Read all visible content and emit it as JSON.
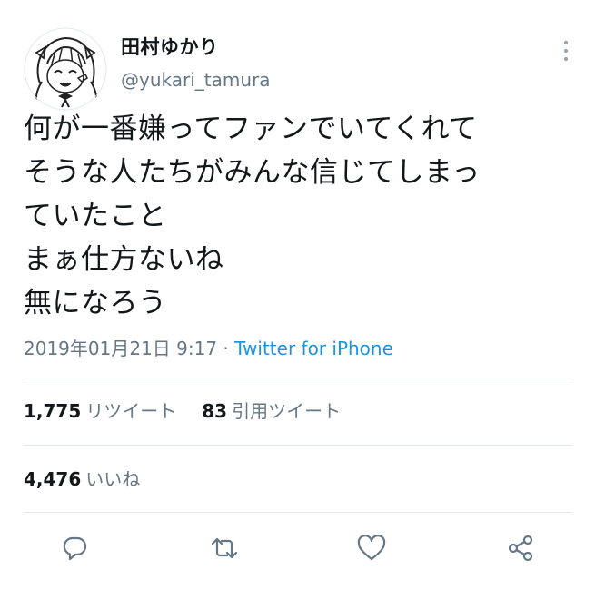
{
  "user": {
    "display_name": "田村ゆかり",
    "handle": "@yukari_tamura",
    "avatar_icon": "avatar-illustration"
  },
  "tweet": {
    "lines": [
      "何が一番嫌ってファンでいてくれて",
      "そうな人たちがみんな信じてしまっ",
      "ていたこと",
      "まぁ仕方ないね",
      "無になろう"
    ],
    "timestamp": "2019年01月21日 9:17 · ",
    "source": "Twitter for iPhone"
  },
  "stats": {
    "retweets_count": "1,775",
    "retweets_label": "リツイート",
    "quotes_count": "83",
    "quotes_label": "引用ツイート",
    "likes_count": "4,476",
    "likes_label": "いいね"
  },
  "actions": {
    "reply_icon": "reply-icon",
    "retweet_icon": "retweet-icon",
    "like_icon": "heart-icon",
    "share_icon": "share-icon",
    "more_icon": "more-vertical-icon"
  },
  "colors": {
    "text_primary": "#14171a",
    "text_secondary": "#657786",
    "link": "#1b95e0",
    "divider": "#e1e8ed",
    "icon": "#657786"
  }
}
